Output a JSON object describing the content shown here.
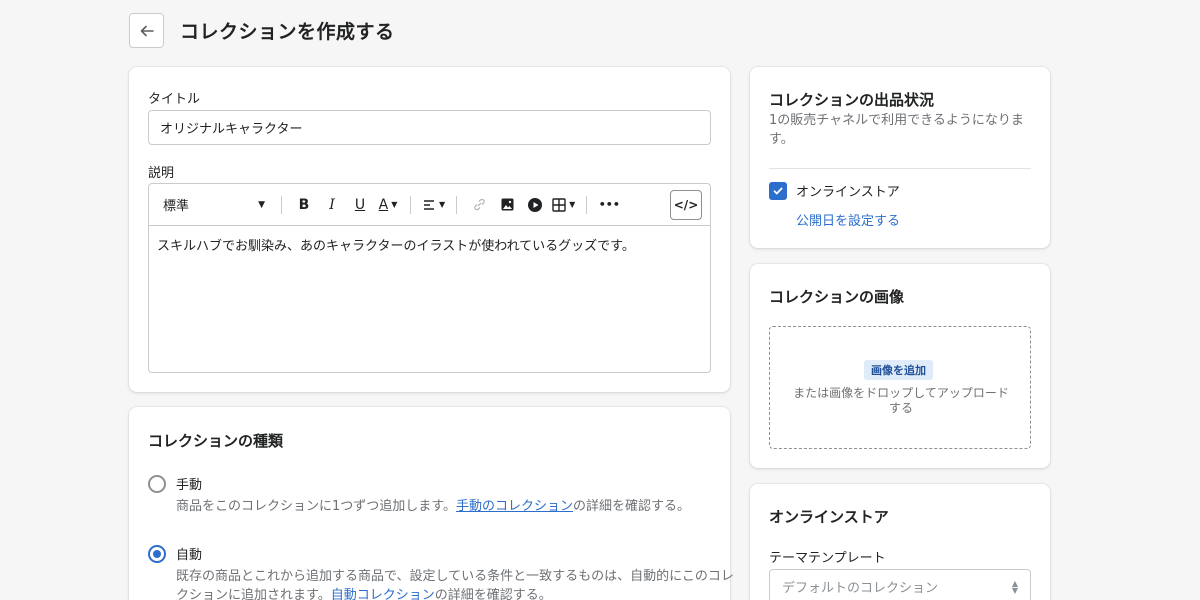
{
  "header": {
    "title": "コレクションを作成する"
  },
  "title_field": {
    "label": "タイトル",
    "value": "オリジナルキャラクター"
  },
  "description": {
    "label": "説明",
    "format_label": "標準",
    "body": "スキルハブでお馴染み、あのキャラクターのイラストが使われているグッズです。",
    "toolbar": {
      "bold": "B",
      "italic": "I",
      "underline": "U",
      "color": "A",
      "more": "•••",
      "code": "</>"
    }
  },
  "collection_type": {
    "heading": "コレクションの種類",
    "options": [
      {
        "label": "手動",
        "help_prefix": "商品をこのコレクションに1つずつ追加します。",
        "help_link": "手動のコレクション",
        "help_suffix": "の詳細を確認する。",
        "selected": false
      },
      {
        "label": "自動",
        "help_prefix": "既存の商品とこれから追加する商品で、設定している条件と一致するものは、自動的にこのコレクションに追加されます。",
        "help_link": "自動コレクション",
        "help_suffix": "の詳細を確認する。",
        "selected": true
      }
    ]
  },
  "availability": {
    "heading": "コレクションの出品状況",
    "subtext": "1の販売チャネルで利用できるようになります。",
    "channel_label": "オンラインストア",
    "channel_checked": true,
    "schedule_link": "公開日を設定する"
  },
  "image_card": {
    "heading": "コレクションの画像",
    "add_button": "画像を追加",
    "drop_hint": "または画像をドロップしてアップロードする"
  },
  "online_store": {
    "heading": "オンラインストア",
    "template_label": "テーマテンプレート",
    "template_value": "デフォルトのコレクション"
  },
  "colors": {
    "accent": "#2c6ecb",
    "background": "#f6f6f7",
    "border": "#c9cccf"
  }
}
